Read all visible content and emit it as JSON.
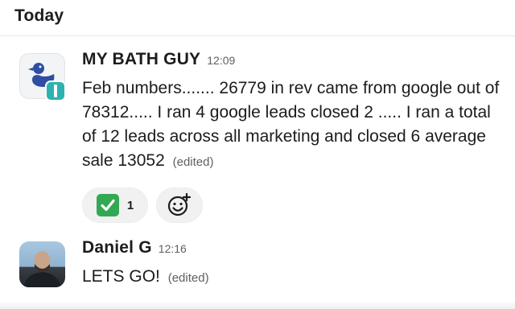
{
  "channel": {
    "day_label": "Today"
  },
  "messages": [
    {
      "sender": "MY BATH GUY",
      "time": "12:09",
      "text": "Feb numbers....... 26779 in rev came from google out of 78312..... I ran 4 google leads closed 2 ..... I ran a total of 12 leads across all marketing and closed 6 average sale 13052",
      "edited_label": "(edited)",
      "avatar_icon": "duck-logo-icon",
      "badge_icon": "app-badge-icon",
      "reactions": [
        {
          "emoji_icon": "white-check-mark-icon",
          "count": "1"
        }
      ],
      "add_reaction_icon": "add-emoji-icon"
    },
    {
      "sender": "Daniel G",
      "time": "12:16",
      "text": "LETS GO!",
      "edited_label": "(edited)",
      "avatar_icon": "user-photo"
    }
  ],
  "colors": {
    "check_green": "#33a853",
    "duck_blue": "#2d4ea3",
    "badge_teal": "#2bb3b1",
    "muted_text": "#616061"
  }
}
